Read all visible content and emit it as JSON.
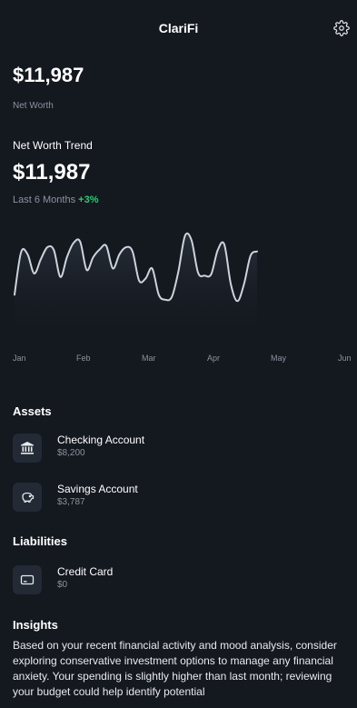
{
  "app": {
    "title": "ClariFi",
    "settings_icon": "gear-icon"
  },
  "summary": {
    "net_worth": "$11,987",
    "net_worth_label": "Net Worth"
  },
  "trend": {
    "title": "Net Worth Trend",
    "value": "$11,987",
    "period": "Last 6 Months",
    "change": "+3%",
    "change_color": "#2ecc71",
    "line_color": "#cdd3dc"
  },
  "chart_data": {
    "type": "area",
    "categories": [
      "Jan",
      "Feb",
      "Mar",
      "Apr",
      "May",
      "Jun"
    ],
    "series": [
      {
        "values": [
          0.15,
          0.75,
          0.72,
          0.45,
          0.65,
          0.82,
          0.78,
          0.4,
          0.68,
          0.88,
          0.9,
          0.5,
          0.68,
          0.79,
          0.84,
          0.52,
          0.72,
          0.82,
          0.76,
          0.35,
          0.38,
          0.52,
          0.15,
          0.08,
          0.12,
          0.48,
          0.98,
          0.92,
          0.46,
          0.42,
          0.44,
          0.78,
          0.86,
          0.3,
          0.06,
          0.3,
          0.7,
          0.76
        ]
      }
    ],
    "x_range": [
      "Jan",
      "Jun"
    ],
    "grid": false,
    "legend": "none"
  },
  "assets": {
    "title": "Assets",
    "items": [
      {
        "name": "Checking Account",
        "amount": "$8,200",
        "icon": "bank-icon"
      },
      {
        "name": "Savings Account",
        "amount": "$3,787",
        "icon": "piggy-bank-icon"
      }
    ]
  },
  "liabilities": {
    "title": "Liabilities",
    "items": [
      {
        "name": "Credit Card",
        "amount": "$0",
        "icon": "credit-card-icon"
      }
    ]
  },
  "insights": {
    "title": "Insights",
    "text": "Based on your recent financial activity and mood analysis, consider exploring conservative investment options to manage any financial anxiety. Your spending is slightly higher than last month; reviewing your budget could help identify potential"
  }
}
